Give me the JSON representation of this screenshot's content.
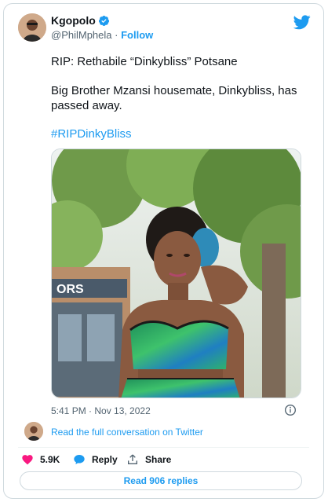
{
  "author": {
    "name": "Kgopolo",
    "handle": "@PhilMphela",
    "separator": "·",
    "follow_label": "Follow"
  },
  "tweet": {
    "line1": "RIP: Rethabile “Dinkybliss” Potsane",
    "line2": "Big Brother Mzansi housemate, Dinkybliss, has passed away.",
    "hashtag": "#RIPDinkyBliss",
    "timestamp": "5:41 PM · Nov 13, 2022"
  },
  "conversation": {
    "link_text": "Read the full conversation on Twitter"
  },
  "actions": {
    "like_count": "5.9K",
    "reply_label": "Reply",
    "share_label": "Share",
    "read_replies_label": "Read 906 replies"
  },
  "colors": {
    "accent": "#1d9bf0",
    "like": "#f91880",
    "muted": "#536471"
  },
  "icons": [
    "verified-badge-icon",
    "twitter-bird-icon",
    "info-icon",
    "heart-icon",
    "reply-bubble-icon",
    "share-icon"
  ]
}
